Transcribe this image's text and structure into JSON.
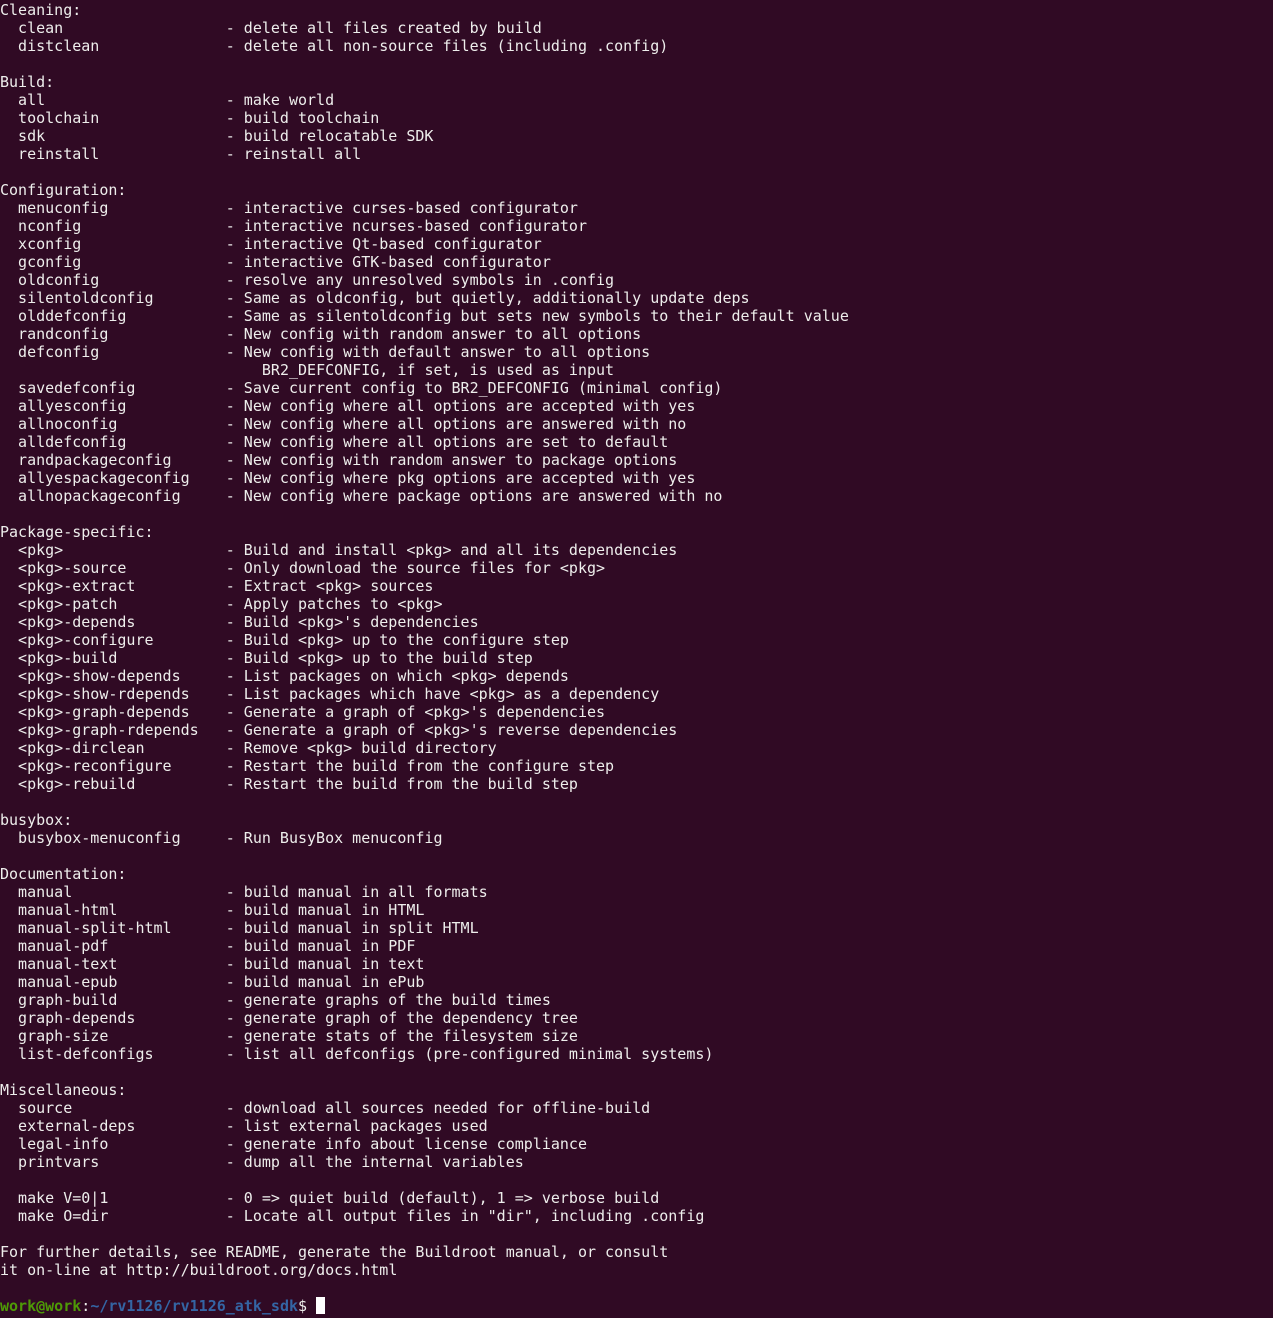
{
  "terminal": {
    "colors": {
      "background": "#300a24",
      "text": "#eeeeec",
      "user": "#4e9a06",
      "path": "#3465a4"
    },
    "lines": [
      {
        "h": "Cleaning:"
      },
      {
        "t": "clean",
        "d": "- delete all files created by build"
      },
      {
        "t": "distclean",
        "d": "- delete all non-source files (including .config)"
      },
      {},
      {
        "h": "Build:"
      },
      {
        "t": "all",
        "d": "- make world"
      },
      {
        "t": "toolchain",
        "d": "- build toolchain"
      },
      {
        "t": "sdk",
        "d": "- build relocatable SDK"
      },
      {
        "t": "reinstall",
        "d": "- reinstall all"
      },
      {},
      {
        "h": "Configuration:"
      },
      {
        "t": "menuconfig",
        "d": "- interactive curses-based configurator"
      },
      {
        "t": "nconfig",
        "d": "- interactive ncurses-based configurator"
      },
      {
        "t": "xconfig",
        "d": "- interactive Qt-based configurator"
      },
      {
        "t": "gconfig",
        "d": "- interactive GTK-based configurator"
      },
      {
        "t": "oldconfig",
        "d": "- resolve any unresolved symbols in .config"
      },
      {
        "t": "silentoldconfig",
        "d": "- Same as oldconfig, but quietly, additionally update deps"
      },
      {
        "t": "olddefconfig",
        "d": "- Same as silentoldconfig but sets new symbols to their default value"
      },
      {
        "t": "randconfig",
        "d": "- New config with random answer to all options"
      },
      {
        "t": "defconfig",
        "d": "- New config with default answer to all options"
      },
      {
        "c": "BR2_DEFCONFIG, if set, is used as input"
      },
      {
        "t": "savedefconfig",
        "d": "- Save current config to BR2_DEFCONFIG (minimal config)"
      },
      {
        "t": "allyesconfig",
        "d": "- New config where all options are accepted with yes"
      },
      {
        "t": "allnoconfig",
        "d": "- New config where all options are answered with no"
      },
      {
        "t": "alldefconfig",
        "d": "- New config where all options are set to default"
      },
      {
        "t": "randpackageconfig",
        "d": "- New config with random answer to package options"
      },
      {
        "t": "allyespackageconfig",
        "d": "- New config where pkg options are accepted with yes"
      },
      {
        "t": "allnopackageconfig",
        "d": "- New config where package options are answered with no"
      },
      {},
      {
        "h": "Package-specific:"
      },
      {
        "t": "<pkg>",
        "d": "- Build and install <pkg> and all its dependencies"
      },
      {
        "t": "<pkg>-source",
        "d": "- Only download the source files for <pkg>"
      },
      {
        "t": "<pkg>-extract",
        "d": "- Extract <pkg> sources"
      },
      {
        "t": "<pkg>-patch",
        "d": "- Apply patches to <pkg>"
      },
      {
        "t": "<pkg>-depends",
        "d": "- Build <pkg>'s dependencies"
      },
      {
        "t": "<pkg>-configure",
        "d": "- Build <pkg> up to the configure step"
      },
      {
        "t": "<pkg>-build",
        "d": "- Build <pkg> up to the build step"
      },
      {
        "t": "<pkg>-show-depends",
        "d": "- List packages on which <pkg> depends"
      },
      {
        "t": "<pkg>-show-rdepends",
        "d": "- List packages which have <pkg> as a dependency"
      },
      {
        "t": "<pkg>-graph-depends",
        "d": "- Generate a graph of <pkg>'s dependencies"
      },
      {
        "t": "<pkg>-graph-rdepends",
        "d": "- Generate a graph of <pkg>'s reverse dependencies"
      },
      {
        "t": "<pkg>-dirclean",
        "d": "- Remove <pkg> build directory"
      },
      {
        "t": "<pkg>-reconfigure",
        "d": "- Restart the build from the configure step"
      },
      {
        "t": "<pkg>-rebuild",
        "d": "- Restart the build from the build step"
      },
      {},
      {
        "h": "busybox:"
      },
      {
        "t": "busybox-menuconfig",
        "d": "- Run BusyBox menuconfig"
      },
      {},
      {
        "h": "Documentation:"
      },
      {
        "t": "manual",
        "d": "- build manual in all formats"
      },
      {
        "t": "manual-html",
        "d": "- build manual in HTML"
      },
      {
        "t": "manual-split-html",
        "d": "- build manual in split HTML"
      },
      {
        "t": "manual-pdf",
        "d": "- build manual in PDF"
      },
      {
        "t": "manual-text",
        "d": "- build manual in text"
      },
      {
        "t": "manual-epub",
        "d": "- build manual in ePub"
      },
      {
        "t": "graph-build",
        "d": "- generate graphs of the build times"
      },
      {
        "t": "graph-depends",
        "d": "- generate graph of the dependency tree"
      },
      {
        "t": "graph-size",
        "d": "- generate stats of the filesystem size"
      },
      {
        "t": "list-defconfigs",
        "d": "- list all defconfigs (pre-configured minimal systems)"
      },
      {},
      {
        "h": "Miscellaneous:"
      },
      {
        "t": "source",
        "d": "- download all sources needed for offline-build"
      },
      {
        "t": "external-deps",
        "d": "- list external packages used"
      },
      {
        "t": "legal-info",
        "d": "- generate info about license compliance"
      },
      {
        "t": "printvars",
        "d": "- dump all the internal variables"
      },
      {},
      {
        "t": "make V=0|1",
        "d": "- 0 => quiet build (default), 1 => verbose build"
      },
      {
        "t": "make O=dir",
        "d": "- Locate all output files in \"dir\", including .config"
      },
      {},
      {
        "h": "For further details, see README, generate the Buildroot manual, or consult"
      },
      {
        "h": "it on-line at http://buildroot.org/docs.html"
      },
      {}
    ],
    "prompt": {
      "user": "work@work",
      "sep": ":",
      "path": "~/rv1126/rv1126_atk_sdk",
      "symbol": "$"
    }
  }
}
